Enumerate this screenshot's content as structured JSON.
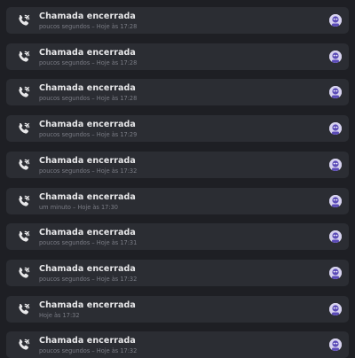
{
  "notifications": [
    {
      "title": "Chamada encerrada",
      "subtitle": "poucos segundos – Hoje às 17:28",
      "icon": "phone-call-icon",
      "avatar": "user-avatar"
    },
    {
      "title": "Chamada encerrada",
      "subtitle": "poucos segundos – Hoje às 17:28",
      "icon": "phone-call-icon",
      "avatar": "user-avatar"
    },
    {
      "title": "Chamada encerrada",
      "subtitle": "poucos segundos – Hoje às 17:28",
      "icon": "phone-call-icon",
      "avatar": "user-avatar"
    },
    {
      "title": "Chamada encerrada",
      "subtitle": "poucos segundos – Hoje às 17:29",
      "icon": "phone-call-icon",
      "avatar": "user-avatar"
    },
    {
      "title": "Chamada encerrada",
      "subtitle": "poucos segundos – Hoje às 17:32",
      "icon": "phone-call-icon",
      "avatar": "user-avatar"
    },
    {
      "title": "Chamada encerrada",
      "subtitle": "um minuto – Hoje às 17:30",
      "icon": "phone-call-icon",
      "avatar": "user-avatar"
    },
    {
      "title": "Chamada encerrada",
      "subtitle": "poucos segundos – Hoje às 17:31",
      "icon": "phone-call-icon",
      "avatar": "user-avatar"
    },
    {
      "title": "Chamada encerrada",
      "subtitle": "poucos segundos – Hoje às 17:32",
      "icon": "phone-call-icon",
      "avatar": "user-avatar"
    },
    {
      "title": "Chamada encerrada",
      "subtitle": "Hoje às 17:32",
      "icon": "phone-call-icon",
      "avatar": "user-avatar"
    },
    {
      "title": "Chamada encerrada",
      "subtitle": "poucos segundos – Hoje às 17:32",
      "icon": "phone-call-icon",
      "avatar": "user-avatar"
    }
  ],
  "colors": {
    "background": "#1e1f24",
    "card": "#2b2d33",
    "title": "#e8e8ea",
    "subtitle": "#7a7c85",
    "avatar_bg": "#d7d3ef",
    "avatar_fg": "#5b4bb7"
  }
}
